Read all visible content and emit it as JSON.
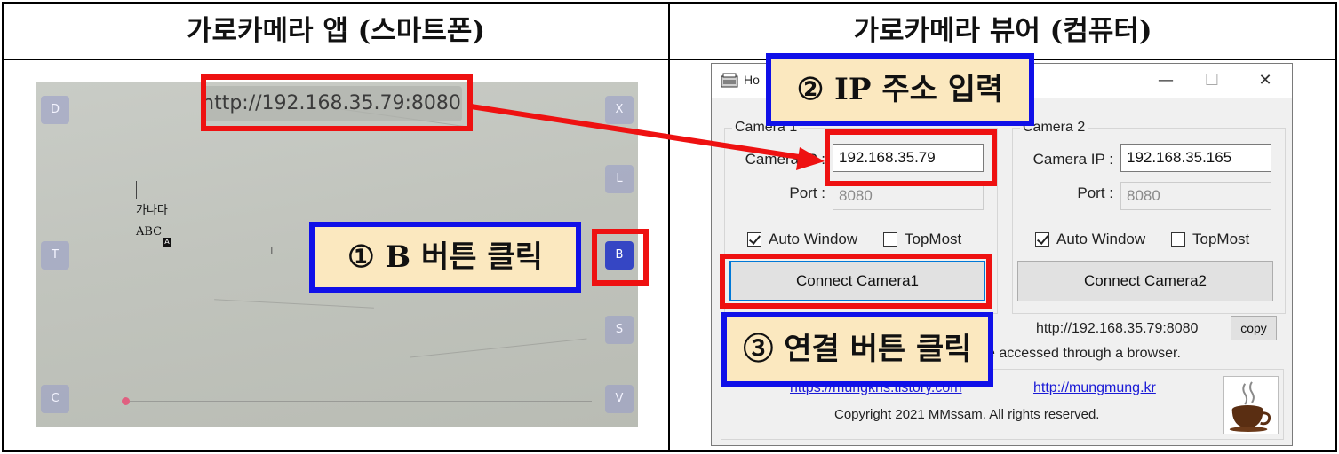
{
  "headers": {
    "left": "가로카메라 앱 (스마트폰)",
    "right": "가로카메라 뷰어 (컴퓨터)"
  },
  "phone": {
    "url": "http://192.168.35.79:8080",
    "left_buttons": [
      "D",
      "T",
      "C"
    ],
    "right_buttons": [
      "X",
      "L",
      "B",
      "S",
      "V"
    ],
    "doc_line1": "가나다",
    "doc_line2": "ABC",
    "doc_badge": "A",
    "cursor": "I"
  },
  "window": {
    "title": "Ho",
    "controls": {
      "minimize": "—",
      "maximize": "☐",
      "close": "✕"
    },
    "camera1": {
      "legend": "Camera 1",
      "ip_label": "Camera IP :",
      "ip_value": "192.168.35.79",
      "port_label": "Port :",
      "port_value": "8080",
      "auto_window": "Auto Window",
      "auto_window_checked": true,
      "topmost": "TopMost",
      "topmost_checked": false,
      "connect": "Connect Camera1"
    },
    "camera2": {
      "legend": "Camera 2",
      "ip_label": "Camera IP :",
      "ip_value": "192.168.35.165",
      "port_label": "Port :",
      "port_value": "8080",
      "auto_window": "Auto Window",
      "auto_window_checked": true,
      "topmost": "TopMost",
      "topmost_checked": false,
      "connect": "Connect Camera2"
    },
    "server_url": "http://192.168.35.79:8080",
    "copy": "copy",
    "browser_note": "e accessed through a browser.",
    "link1": "https://mungkns.tistory.com",
    "link2": "http://mungmung.kr",
    "copyright": "Copyright 2021 MMssam. All rights reserved."
  },
  "annotations": {
    "step1": "① B 버튼 클릭",
    "step2": "② IP 주소 입력",
    "step3": "③ 연결 버튼 클릭"
  },
  "colors": {
    "highlight_red": "#ee1111",
    "callout_blue": "#1010e8",
    "callout_fill": "#fbe8bf",
    "active_button": "#3546c4"
  }
}
